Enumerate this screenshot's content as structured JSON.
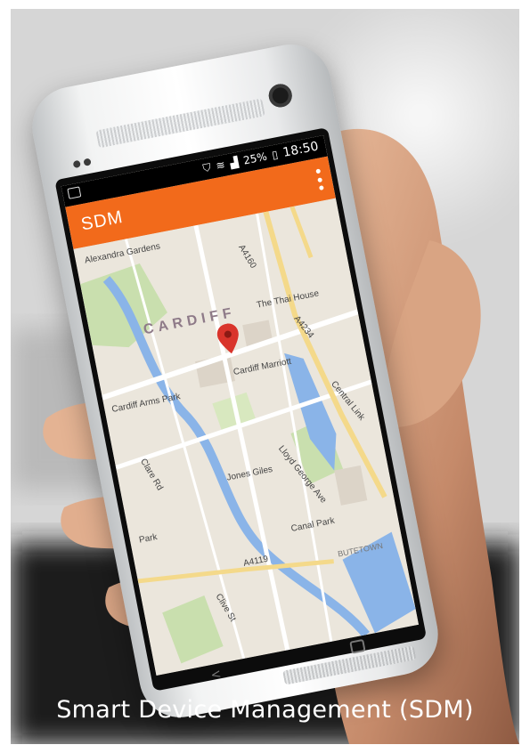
{
  "app": {
    "title": "SDM",
    "accent_color": "#f26a1b"
  },
  "status_bar": {
    "battery": "25%",
    "time": "18:50"
  },
  "map": {
    "labels": {
      "alexandra_gardens": "Alexandra Gardens",
      "cardiff": "CARDIFF",
      "thai_house": "The Thai House",
      "cardiff_arms_park": "Cardiff Arms Park",
      "cardiff_marriott": "Cardiff Marriott",
      "jones_giles": "Jones Giles",
      "lloyd_george_ave": "Lloyd George Ave",
      "central_link": "Central Link",
      "clare_rd": "Clare Rd",
      "canal_park": "Canal Park",
      "butetown": "BUTETOWN",
      "a4119": "A4119",
      "a4160": "A4160",
      "a4234": "A4234",
      "clive_st": "Clive St",
      "park": "Park"
    }
  },
  "caption": "Smart Device Management (SDM)"
}
